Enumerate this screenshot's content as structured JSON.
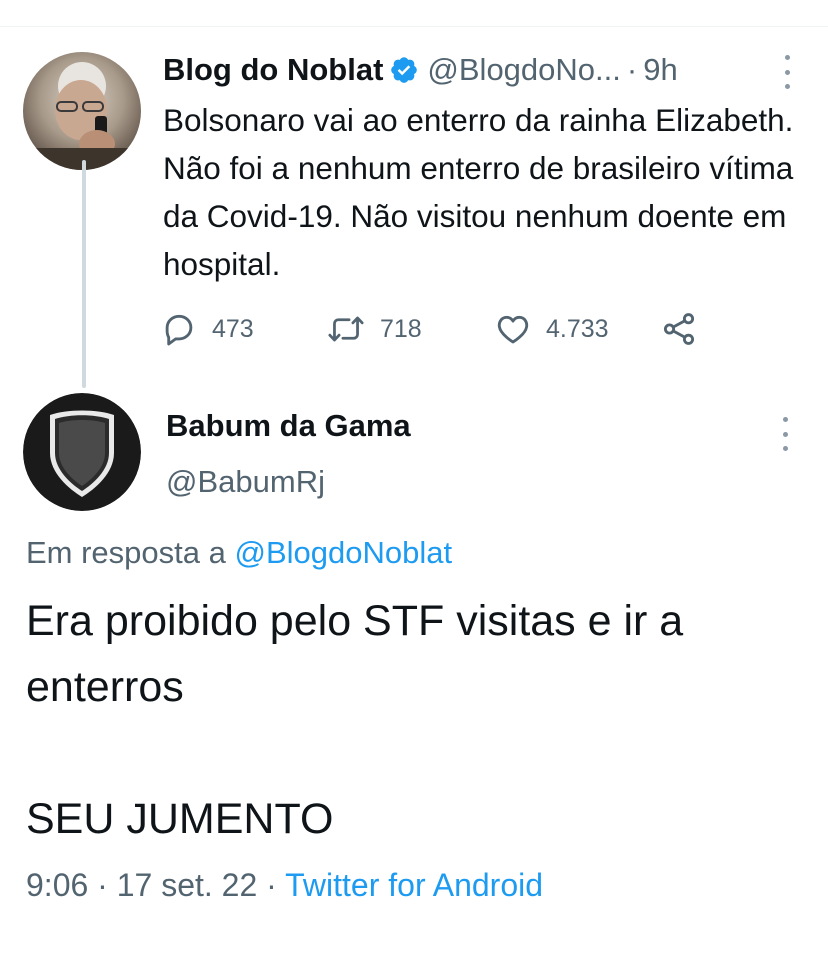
{
  "thread": [
    {
      "author": {
        "name": "Blog do Noblat",
        "handle": "@BlogdoNo...",
        "verified": true,
        "avatar_icon": "profile-photo"
      },
      "time_separator": "·",
      "time": "9h",
      "text": "Bolsonaro vai ao enterro da rainha Elizabeth. Não foi a nenhum enterro de brasileiro vítima da Covid-19. Não visitou nenhum doente em hospital.",
      "stats": {
        "replies": "473",
        "retweets": "718",
        "likes": "4.733"
      }
    }
  ],
  "main_tweet": {
    "author": {
      "name": "Babum da Gama",
      "handle": "@BabumRj",
      "avatar_icon": "shield-crest"
    },
    "reply_prefix": "Em resposta a",
    "reply_to": "@BlogdoNoblat",
    "text_lines": [
      "Era proibido pelo STF visitas e ir a enterros",
      "",
      "SEU JUMENTO"
    ],
    "meta": {
      "time": "9:06",
      "separator1": "·",
      "date": "17 set. 22",
      "separator2": "·",
      "source": "Twitter for Android"
    }
  },
  "colors": {
    "text": "#0f1419",
    "secondary": "#536471",
    "link": "#1d9bf0",
    "verified": "#1d9bf0",
    "thread_line": "#cfd9de"
  }
}
